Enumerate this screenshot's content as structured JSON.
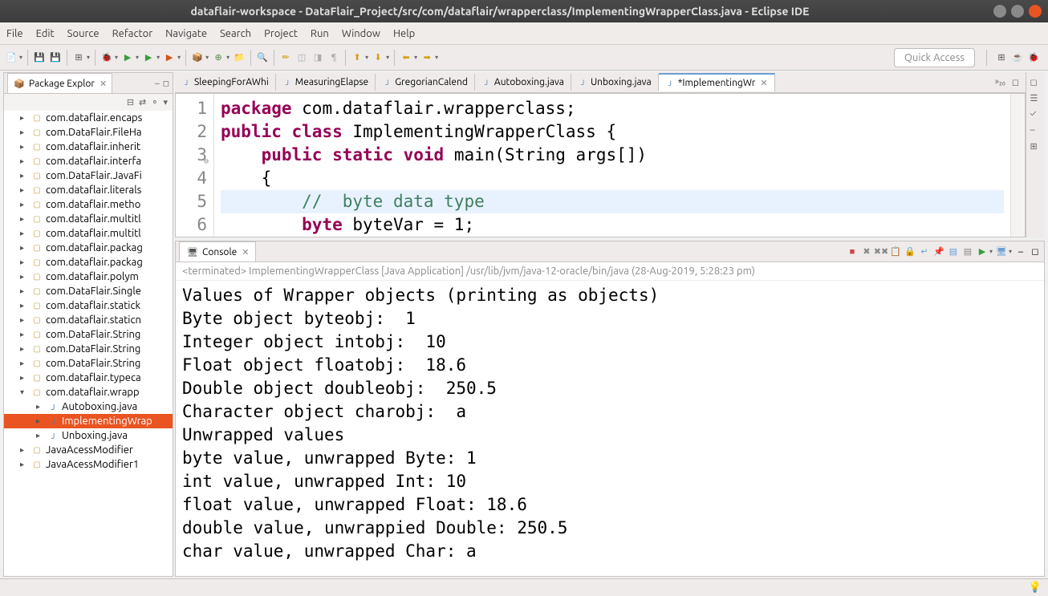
{
  "titlebar": {
    "title": "dataflair-workspace - DataFlair_Project/src/com/dataflair/wrapperclass/ImplementingWrapperClass.java - Eclipse IDE"
  },
  "menubar": [
    "File",
    "Edit",
    "Source",
    "Refactor",
    "Navigate",
    "Search",
    "Project",
    "Run",
    "Window",
    "Help"
  ],
  "quick_access": "Quick Access",
  "package_explorer": {
    "title": "Package Explor",
    "items": [
      {
        "label": "com.dataflair.encaps",
        "level": 1,
        "expanded": false,
        "type": "pkg"
      },
      {
        "label": "com.DataFlair.FileHa",
        "level": 1,
        "expanded": false,
        "type": "pkg"
      },
      {
        "label": "com.dataflair.inherit",
        "level": 1,
        "expanded": false,
        "type": "pkg"
      },
      {
        "label": "com.dataflair.interfa",
        "level": 1,
        "expanded": false,
        "type": "pkg"
      },
      {
        "label": "com.DataFlair.JavaFi",
        "level": 1,
        "expanded": false,
        "type": "pkg"
      },
      {
        "label": "com.dataflair.literals",
        "level": 1,
        "expanded": false,
        "type": "pkg"
      },
      {
        "label": "com.dataflair.metho",
        "level": 1,
        "expanded": false,
        "type": "pkg"
      },
      {
        "label": "com.dataflair.multitl",
        "level": 1,
        "expanded": false,
        "type": "pkg"
      },
      {
        "label": "com.dataflair.multitl",
        "level": 1,
        "expanded": false,
        "type": "pkg"
      },
      {
        "label": "com.dataflair.packag",
        "level": 1,
        "expanded": false,
        "type": "pkg"
      },
      {
        "label": "com.dataflair.packag",
        "level": 1,
        "expanded": false,
        "type": "pkg"
      },
      {
        "label": "com.dataflair.polym",
        "level": 1,
        "expanded": false,
        "type": "pkg"
      },
      {
        "label": "com.DataFlair.Single",
        "level": 1,
        "expanded": false,
        "type": "pkg"
      },
      {
        "label": "com.dataflair.statick",
        "level": 1,
        "expanded": false,
        "type": "pkg"
      },
      {
        "label": "com.dataflair.staticn",
        "level": 1,
        "expanded": false,
        "type": "pkg"
      },
      {
        "label": "com.DataFlair.String",
        "level": 1,
        "expanded": false,
        "type": "pkg"
      },
      {
        "label": "com.DataFlair.String",
        "level": 1,
        "expanded": false,
        "type": "pkg"
      },
      {
        "label": "com.DataFlair.String",
        "level": 1,
        "expanded": false,
        "type": "pkg"
      },
      {
        "label": "com.dataflair.typeca",
        "level": 1,
        "expanded": false,
        "type": "pkg"
      },
      {
        "label": "com.dataflair.wrapp",
        "level": 1,
        "expanded": true,
        "type": "pkg"
      },
      {
        "label": "Autoboxing.java",
        "level": 2,
        "expanded": false,
        "type": "java"
      },
      {
        "label": "ImplementingWrap",
        "level": 2,
        "expanded": false,
        "type": "java",
        "selected": true
      },
      {
        "label": "Unboxing.java",
        "level": 2,
        "expanded": false,
        "type": "java"
      },
      {
        "label": "JavaAcessModifier",
        "level": 1,
        "expanded": false,
        "type": "java-pkg"
      },
      {
        "label": "JavaAcessModifier1",
        "level": 1,
        "expanded": false,
        "type": "java-pkg"
      }
    ]
  },
  "editor_tabs": [
    {
      "label": "SleepingForAWhi",
      "active": false
    },
    {
      "label": "MeasuringElapse",
      "active": false
    },
    {
      "label": "GregorianCalend",
      "active": false
    },
    {
      "label": "Autoboxing.java",
      "active": false
    },
    {
      "label": "Unboxing.java",
      "active": false
    },
    {
      "label": "*ImplementingWr",
      "active": true
    }
  ],
  "tab_overflow": "»₂₀",
  "code_lines": [
    {
      "n": "1",
      "tokens": [
        {
          "t": "package",
          "c": "kw"
        },
        {
          "t": " com.dataflair.wrapperclass;",
          "c": ""
        }
      ]
    },
    {
      "n": "2",
      "tokens": [
        {
          "t": "public",
          "c": "kw"
        },
        {
          "t": " ",
          "c": ""
        },
        {
          "t": "class",
          "c": "kw"
        },
        {
          "t": " ImplementingWrapperClass {",
          "c": ""
        }
      ]
    },
    {
      "n": "3",
      "tokens": [
        {
          "t": "    ",
          "c": ""
        },
        {
          "t": "public",
          "c": "kw"
        },
        {
          "t": " ",
          "c": ""
        },
        {
          "t": "static",
          "c": "kw"
        },
        {
          "t": " ",
          "c": ""
        },
        {
          "t": "void",
          "c": "kw"
        },
        {
          "t": " main(String args[])",
          "c": ""
        }
      ]
    },
    {
      "n": "4",
      "tokens": [
        {
          "t": "    {",
          "c": ""
        }
      ]
    },
    {
      "n": "5",
      "tokens": [
        {
          "t": "        ",
          "c": ""
        },
        {
          "t": "//  byte data type",
          "c": "cm"
        }
      ],
      "hl": true
    },
    {
      "n": "6",
      "tokens": [
        {
          "t": "        ",
          "c": ""
        },
        {
          "t": "byte",
          "c": "kw"
        },
        {
          "t": " byteVar = 1;",
          "c": ""
        }
      ]
    }
  ],
  "console": {
    "title": "Console",
    "status": "<terminated> ImplementingWrapperClass [Java Application] /usr/lib/jvm/java-12-oracle/bin/java (28-Aug-2019, 5:28:23 pm)",
    "output": "Values of Wrapper objects (printing as objects)\nByte object byteobj:  1\nInteger object intobj:  10\nFloat object floatobj:  18.6\nDouble object doubleobj:  250.5\nCharacter object charobj:  a\nUnwrapped values\nbyte value, unwrapped Byte: 1\nint value, unwrapped Int: 10\nfloat value, unwrapped Float: 18.6\ndouble value, unwrappied Double: 250.5\nchar value, unwrapped Char: a"
  }
}
